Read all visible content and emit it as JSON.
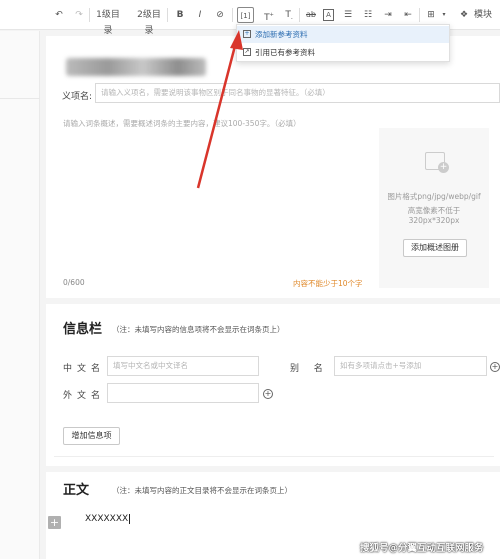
{
  "toolbar": {
    "undo_icon": "undo-icon",
    "redo_icon": "redo-icon",
    "heading1": "1级目录",
    "heading2": "2级目录",
    "bold": "B",
    "italic": "I",
    "link_icon": "link-icon",
    "reference": "[1]",
    "superscript": "T",
    "subscript": "T",
    "strikethrough": "ab",
    "text_box": "A",
    "bullet_list_icon": "bullet-list-icon",
    "numbered_list_icon": "numbered-list-icon",
    "indent_icon": "indent-icon",
    "outdent_icon": "outdent-icon",
    "insert_icon": "insert-icon",
    "template_label": "模块"
  },
  "reference_menu": {
    "items": [
      {
        "icon": "[+]",
        "label": "添加新参考资料"
      },
      {
        "icon": "↗",
        "label": "引用已有参考资料"
      }
    ]
  },
  "entry": {
    "yi_label": "义项名:",
    "yi_placeholder": "请输入义项名，需要说明该事物区别于同名事物的显著特征。（必填）",
    "summary_placeholder": "请输入词条概述，需要概述词条的主要内容，建议100-350字。（必填）",
    "count": "0/600",
    "warning": "内容不能少于10个字",
    "image_hint_1": "图片格式png/jpg/webp/gif",
    "image_hint_2": "高宽像素不低于320px*320px",
    "add_image_button": "添加概述图册"
  },
  "infobox": {
    "title": "信息栏",
    "note": "（注：未填写内容的信息项将不会显示在词条页上）",
    "cn_name_label": "中文名",
    "cn_name_placeholder": "填写中文名或中文译名",
    "alias_label": "别  名",
    "alias_placeholder": "如有多项请点击+号添加",
    "foreign_label": "外文名",
    "foreign_value": "",
    "add_item_button": "增加信息项"
  },
  "body_section": {
    "title": "正文",
    "note": "（注：未填写内容的正文目录将不会显示在词条页上）",
    "content": "XXXXXXX"
  },
  "watermark": "搜狐号@分翼互动互联网服务"
}
